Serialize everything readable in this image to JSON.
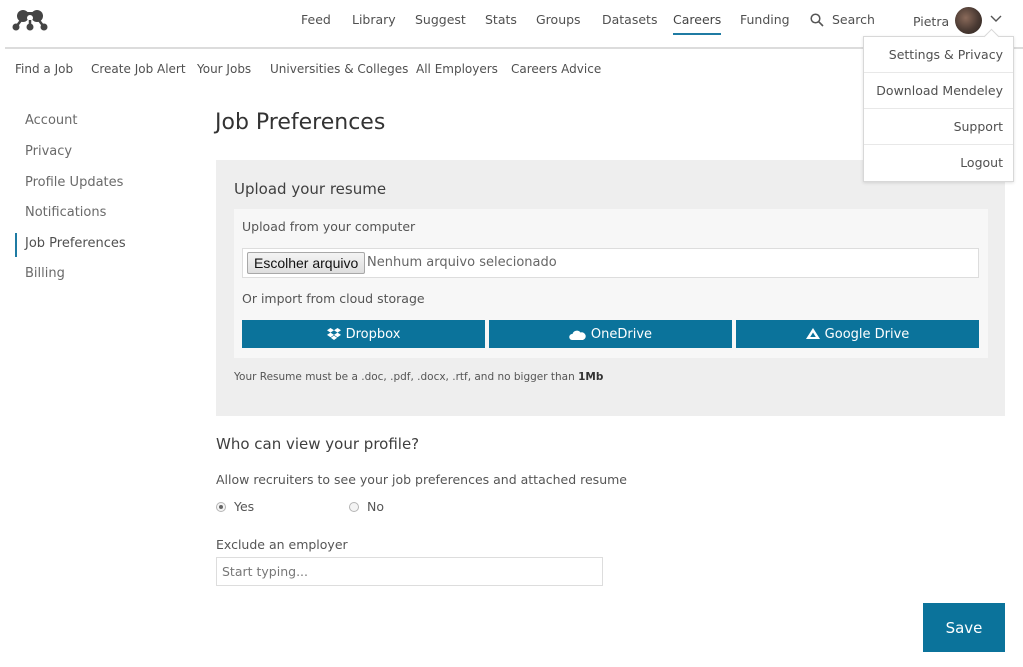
{
  "topnav": {
    "logo": "mendeley-logo-icon",
    "items": [
      {
        "label": "Feed",
        "active": false
      },
      {
        "label": "Library",
        "active": false
      },
      {
        "label": "Suggest",
        "active": false
      },
      {
        "label": "Stats",
        "active": false
      },
      {
        "label": "Groups",
        "active": false
      },
      {
        "label": "Datasets",
        "active": false
      },
      {
        "label": "Careers",
        "active": true
      },
      {
        "label": "Funding",
        "active": false
      }
    ],
    "search_label": "Search",
    "user_name": "Pietra",
    "accent_color": "#1f7ba3"
  },
  "user_menu": {
    "items": [
      "Settings & Privacy",
      "Download Mendeley",
      "Support",
      "Logout"
    ]
  },
  "subnav": {
    "items": [
      "Find a Job",
      "Create Job Alert",
      "Your Jobs",
      "Universities & Colleges",
      "All Employers",
      "Careers Advice"
    ]
  },
  "sidebar": {
    "items": [
      {
        "label": "Account",
        "active": false
      },
      {
        "label": "Privacy",
        "active": false
      },
      {
        "label": "Profile Updates",
        "active": false
      },
      {
        "label": "Notifications",
        "active": false
      },
      {
        "label": "Job Preferences",
        "active": true
      },
      {
        "label": "Billing",
        "active": false
      }
    ]
  },
  "main": {
    "title": "Job Preferences",
    "upload": {
      "title": "Upload your resume",
      "from_computer_label": "Upload from your computer",
      "file_button": "Escolher arquivo",
      "file_status": "Nenhum arquivo selecionado",
      "cloud_label": "Or import from cloud storage",
      "cloud_buttons": [
        {
          "label": "Dropbox",
          "icon": "dropbox-icon"
        },
        {
          "label": "OneDrive",
          "icon": "onedrive-icon"
        },
        {
          "label": "Google Drive",
          "icon": "google-drive-icon"
        }
      ],
      "note_prefix": "Your Resume must be a .doc, .pdf, .docx, .rtf, and no bigger than ",
      "note_limit": "1Mb"
    },
    "visibility": {
      "title": "Who can view your profile?",
      "question": "Allow recruiters to see your job preferences and attached resume",
      "options": [
        {
          "label": "Yes",
          "checked": true
        },
        {
          "label": "No",
          "checked": false
        }
      ]
    },
    "exclude": {
      "label": "Exclude an employer",
      "placeholder": "Start typing...",
      "value": ""
    },
    "save_label": "Save",
    "button_color": "#0b739b"
  }
}
